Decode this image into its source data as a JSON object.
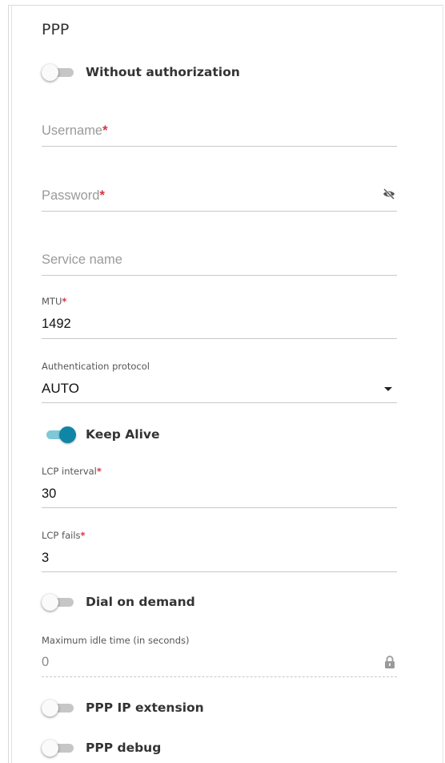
{
  "section": {
    "title": "PPP"
  },
  "toggles": {
    "without_auth": {
      "label": "Without authorization",
      "on": false
    },
    "keep_alive": {
      "label": "Keep Alive",
      "on": true
    },
    "dial_on_demand": {
      "label": "Dial on demand",
      "on": false
    },
    "ppp_ip_extension": {
      "label": "PPP IP extension",
      "on": false
    },
    "ppp_debug": {
      "label": "PPP debug",
      "on": false
    }
  },
  "fields": {
    "username": {
      "placeholder": "Username",
      "required_mark": "*",
      "value": ""
    },
    "password": {
      "placeholder": "Password",
      "required_mark": "*",
      "value": "",
      "icon": "eye-off-icon"
    },
    "service_name": {
      "placeholder": "Service name",
      "value": ""
    },
    "mtu": {
      "label": "MTU",
      "required_mark": "*",
      "value": "1492"
    },
    "auth_protocol": {
      "label": "Authentication protocol",
      "value": "AUTO",
      "icon": "caret-down-icon"
    },
    "lcp_interval": {
      "label": "LCP interval",
      "required_mark": "*",
      "value": "30"
    },
    "lcp_fails": {
      "label": "LCP fails",
      "required_mark": "*",
      "value": "3"
    },
    "max_idle_time": {
      "label": "Maximum idle time (in seconds)",
      "value": "0",
      "icon": "lock-icon",
      "disabled": true
    }
  },
  "colors": {
    "accent": "#1185a6",
    "accent_track": "#7fc8d8",
    "required": "#d9333f"
  }
}
